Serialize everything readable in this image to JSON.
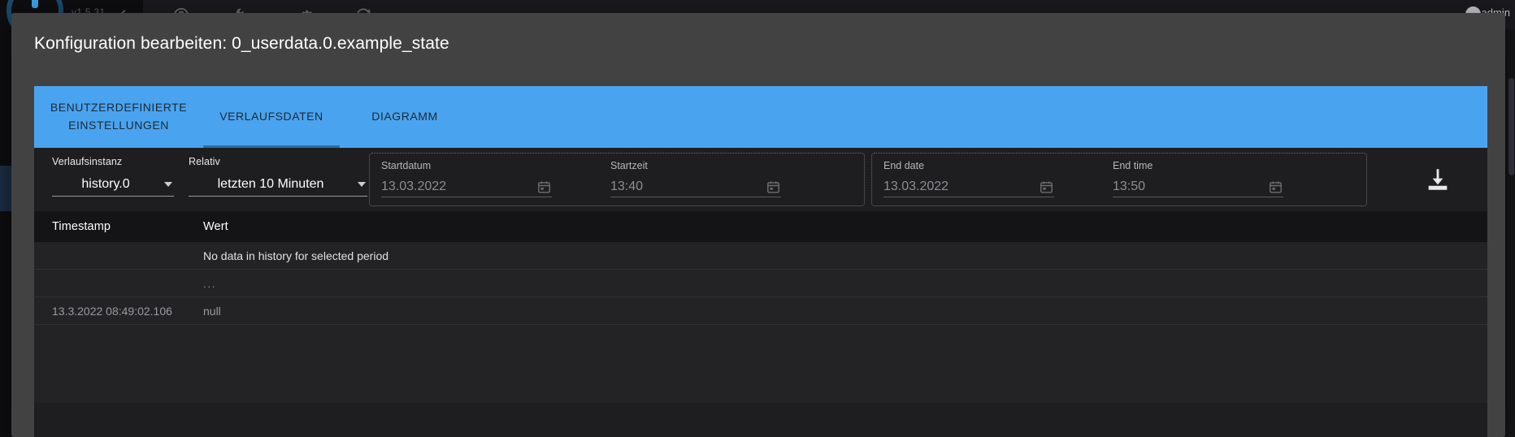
{
  "app": {
    "version": "v1.5.31",
    "username": "admin",
    "topbar_icons": [
      "back-arrow-icon",
      "help-circle-icon",
      "wrench-icon",
      "gear-icon",
      "refresh-icon"
    ],
    "sidebar_items": [
      {
        "name": "sidebar-item-dashboard",
        "icon": "grid-apps-icon",
        "active": false
      },
      {
        "name": "sidebar-item-adapters",
        "icon": "shop-icon",
        "active": false
      },
      {
        "name": "sidebar-item-instances",
        "icon": "instances-icon",
        "active": false
      },
      {
        "name": "sidebar-item-objects",
        "icon": "table-grid-icon",
        "active": true
      },
      {
        "name": "sidebar-item-states",
        "icon": "image-list-icon",
        "active": false
      },
      {
        "name": "sidebar-item-logs",
        "icon": "lines-warning-icon",
        "active": false
      },
      {
        "name": "sidebar-item-users",
        "icon": "person-icon",
        "active": false
      },
      {
        "name": "sidebar-item-hosts",
        "icon": "server-list-icon",
        "active": false
      }
    ]
  },
  "modal": {
    "title": "Konfiguration bearbeiten: 0_userdata.0.example_state"
  },
  "tabs": {
    "items": [
      {
        "label": "BENUTZERDEFINIERTE EINSTELLUNGEN",
        "name": "tab-custom-settings",
        "active": false
      },
      {
        "label": "VERLAUFSDATEN",
        "name": "tab-history-data",
        "active": true
      },
      {
        "label": "DIAGRAMM",
        "name": "tab-chart",
        "active": false
      }
    ]
  },
  "controls": {
    "instance": {
      "label": "Verlaufsinstanz",
      "value": "history.0"
    },
    "relative": {
      "label": "Relativ",
      "value": "letzten 10 Minuten"
    },
    "start_group": {
      "date_label": "Startdatum",
      "date_value": "13.03.2022",
      "time_label": "Startzeit",
      "time_value": "13:40"
    },
    "end_group": {
      "date_label": "End date",
      "date_value": "13.03.2022",
      "time_label": "End time",
      "time_value": "13:50"
    },
    "download": {
      "name": "download-icon",
      "label": "Download"
    }
  },
  "table": {
    "headers": [
      "Timestamp",
      "Wert"
    ],
    "rows": [
      {
        "timestamp": "",
        "value": "No data in history for selected period"
      },
      {
        "timestamp": "",
        "value": "..."
      },
      {
        "timestamp": "13.3.2022 08:49:02.106",
        "value": "null"
      }
    ]
  },
  "colors": {
    "tab_bar": "#4aa3ef",
    "tab_indicator": "#2b6ea3",
    "modal_bg": "#424242",
    "body_bg": "#1e1e20",
    "accent_sidebar": "#1d3148"
  }
}
